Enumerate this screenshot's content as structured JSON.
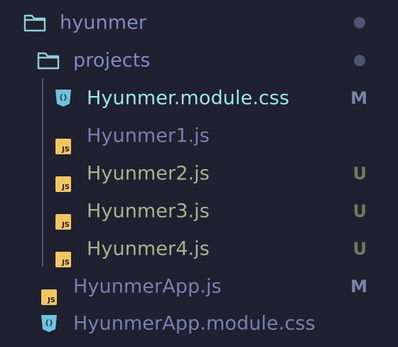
{
  "colors": {
    "background": "#1f2131",
    "folder_icon": "#8fcfd6",
    "folder_label": "#7f8bbf",
    "modified_css": "#9be6dd",
    "untracked": "#a3b58a",
    "plain_file": "#7a80ad",
    "status_m": "#7a86a3",
    "status_u": "#6f7b5e",
    "dot": "#4f566f",
    "js_badge": "#f2c560",
    "css_icon": "#6fc3dd"
  },
  "tree": {
    "root_folder": {
      "label": "hyunmer",
      "icon": "folder-icon"
    },
    "sub_folder": {
      "label": "projects",
      "icon": "folder-icon"
    },
    "files": [
      {
        "label": "Hyunmer.module.css",
        "icon": "css-icon",
        "status": "M"
      },
      {
        "label": "Hyunmer1.js",
        "icon": "js-icon",
        "status": ""
      },
      {
        "label": "Hyunmer2.js",
        "icon": "js-icon",
        "status": "U"
      },
      {
        "label": "Hyunmer3.js",
        "icon": "js-icon",
        "status": "U"
      },
      {
        "label": "Hyunmer4.js",
        "icon": "js-icon",
        "status": "U"
      }
    ],
    "root_files": [
      {
        "label": "HyunmerApp.js",
        "icon": "js-icon",
        "status": "M"
      },
      {
        "label": "HyunmerApp.module.css",
        "icon": "css-icon",
        "status": ""
      }
    ],
    "js_badge_text": "JS"
  }
}
